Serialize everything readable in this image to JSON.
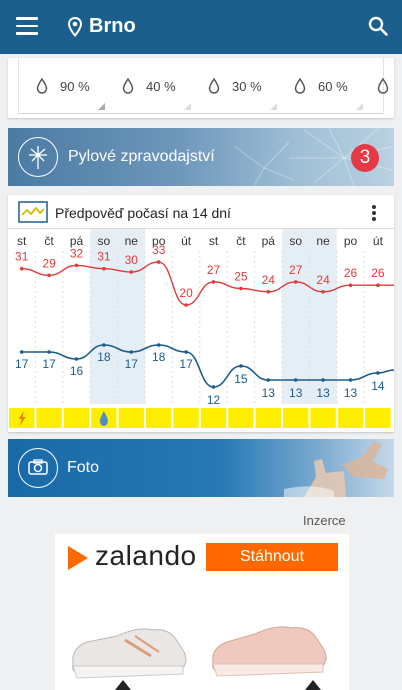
{
  "app": {
    "city": "Brno"
  },
  "precip": {
    "values": [
      "90 %",
      "40 %",
      "30 %",
      "60 %"
    ]
  },
  "pollen": {
    "title": "Pylové zpravodajství",
    "count": "3"
  },
  "forecast": {
    "title": "Předpověď počasí na 14 dní",
    "days": [
      "st",
      "čt",
      "pá",
      "so",
      "ne",
      "po",
      "út",
      "st",
      "čt",
      "pá",
      "so",
      "ne",
      "po",
      "út"
    ],
    "weekend": [
      false,
      false,
      false,
      true,
      true,
      false,
      false,
      false,
      false,
      false,
      true,
      true,
      false,
      false
    ],
    "highs": [
      31,
      29,
      32,
      31,
      30,
      33,
      20,
      27,
      25,
      24,
      27,
      24,
      26,
      26
    ],
    "lows": [
      17,
      17,
      16,
      18,
      17,
      18,
      17,
      12,
      15,
      13,
      13,
      13,
      13,
      14
    ],
    "colors": {
      "high": "#e03a3a",
      "low": "#1a5c8a",
      "weekend": "#e6eef5",
      "strip": "#ffee00"
    },
    "weather_icons": [
      "storm-icon",
      "",
      "",
      "rain-icon",
      "",
      "",
      "",
      "",
      "",
      "",
      "",
      "",
      "",
      ""
    ]
  },
  "foto": {
    "title": "Foto"
  },
  "ad": {
    "label": "Inzerce",
    "brand": "zalando",
    "cta": "Stáhnout"
  }
}
